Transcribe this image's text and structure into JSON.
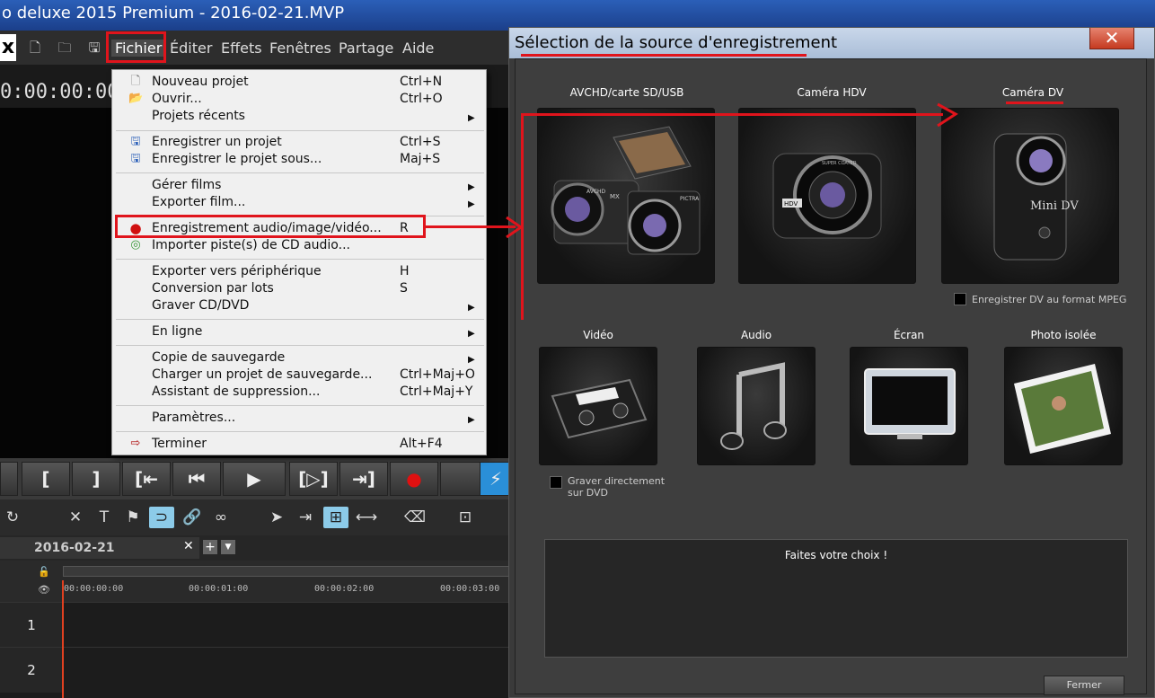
{
  "app": {
    "window_title": "o deluxe 2015 Premium - 2016-02-21.MVP"
  },
  "menubar": {
    "items": [
      "Fichier",
      "Éditer",
      "Effets",
      "Fenêtres",
      "Partage",
      "Aide"
    ]
  },
  "preview": {
    "timecode": "0:00:00:00"
  },
  "file_menu": {
    "items": [
      {
        "label": "Nouveau projet",
        "shortcut": "Ctrl+N"
      },
      {
        "label": "Ouvrir...",
        "shortcut": "Ctrl+O"
      },
      {
        "label": "Projets récents",
        "submenu": "▶"
      },
      {
        "label": "Enregistrer un projet",
        "shortcut": "Ctrl+S"
      },
      {
        "label": "Enregistrer le projet sous...",
        "shortcut": "Maj+S"
      },
      {
        "label": "Gérer films",
        "submenu": "▶"
      },
      {
        "label": "Exporter film...",
        "submenu": "▶"
      },
      {
        "label": "Enregistrement audio/image/vidéo...",
        "shortcut": "R"
      },
      {
        "label": "Importer piste(s) de CD audio..."
      },
      {
        "label": "Exporter vers périphérique",
        "shortcut": "H"
      },
      {
        "label": "Conversion par lots",
        "shortcut": "S"
      },
      {
        "label": "Graver CD/DVD",
        "submenu": "▶"
      },
      {
        "label": "En ligne",
        "submenu": "▶"
      },
      {
        "label": "Copie de sauvegarde",
        "submenu": "▶"
      },
      {
        "label": "Charger un projet de sauvegarde...",
        "shortcut": "Ctrl+Maj+O"
      },
      {
        "label": "Assistant de suppression...",
        "shortcut": "Ctrl+Maj+Y"
      },
      {
        "label": "Paramètres...",
        "submenu": "▶"
      },
      {
        "label": "Terminer",
        "shortcut": "Alt+F4"
      }
    ]
  },
  "timeline": {
    "tab_label": "2016-02-21",
    "ruler": [
      "00:00:00:00",
      "00:00:01:00",
      "00:00:02:00",
      "00:00:03:00"
    ],
    "tracks": [
      "1",
      "2"
    ]
  },
  "dialog": {
    "title": "Sélection de la source d'enregistrement",
    "close_label": "✕",
    "sources": [
      {
        "label": "AVCHD/carte SD/USB"
      },
      {
        "label": "Caméra HDV"
      },
      {
        "label": "Caméra DV"
      },
      {
        "label": "Vidéo"
      },
      {
        "label": "Audio"
      },
      {
        "label": "Écran"
      },
      {
        "label": "Photo isolée"
      }
    ],
    "dv_mpeg_option": "Enregistrer DV au format MPEG",
    "burn_dvd_option_line1": "Graver directement",
    "burn_dvd_option_line2": "sur DVD",
    "info_message": "Faites votre choix !",
    "close_button": "Fermer",
    "camera_marks": {
      "avchd_left": "AVCHD",
      "avchd_mx": "MX",
      "avchd_pictra": "PICTRA",
      "hdv_badge": "HDV",
      "dv_badge": "Mini DV",
      "super_coated": "SUPER COATED"
    }
  },
  "colors": {
    "annotation_red": "#e0141c",
    "highlight_blue": "#8ccbe9",
    "record_red": "#e01010"
  }
}
